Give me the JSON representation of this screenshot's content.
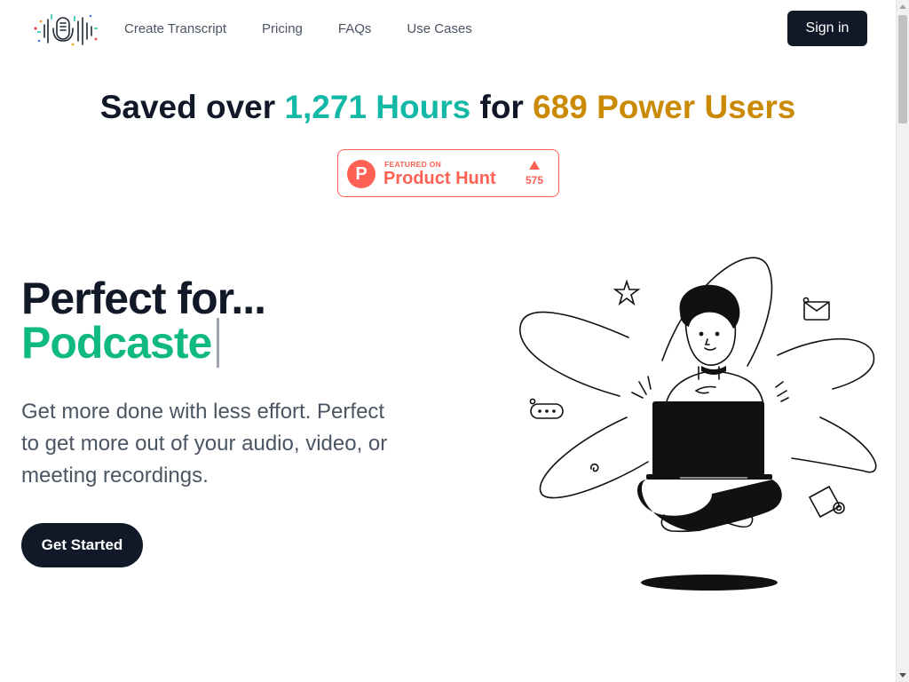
{
  "nav": {
    "logo_icon": "waveform-microphone-logo",
    "items": [
      {
        "label": "Create Transcript"
      },
      {
        "label": "Pricing"
      },
      {
        "label": "FAQs"
      },
      {
        "label": "Use Cases"
      }
    ],
    "signin_label": "Sign in"
  },
  "stats": {
    "prefix": "Saved over",
    "hours": "1,271 Hours",
    "middle": "for",
    "users": "689 Power Users"
  },
  "badge": {
    "letter": "P",
    "featured": "FEATURED ON",
    "name": "Product Hunt",
    "votes": "575"
  },
  "hero": {
    "title": "Perfect for...",
    "typed": "Podcaste",
    "description": "Get more done with less effort. Perfect to get more out of your audio, video, or meeting recordings.",
    "cta_label": "Get Started",
    "illustration_icon": "person-with-laptop-illustration"
  },
  "colors": {
    "dark": "#111827",
    "teal": "#14b8a6",
    "gold": "#ca8a04",
    "green": "#10b981",
    "producthunt": "#ff6154"
  }
}
